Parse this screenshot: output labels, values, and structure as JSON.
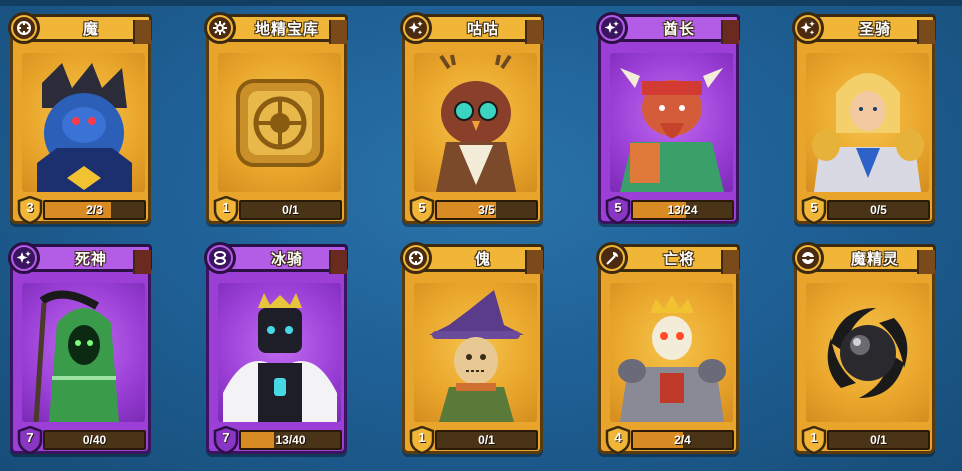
{
  "cards": [
    {
      "name": "魔",
      "level": "3",
      "progress": "2/3",
      "fill": 0.67,
      "rarity": "gold",
      "class_icon": "target-icon",
      "portrait": "demon-knight-portrait"
    },
    {
      "name": "地精宝库",
      "level": "1",
      "progress": "0/1",
      "fill": 0,
      "rarity": "gold",
      "class_icon": "gear-icon",
      "portrait": "goblin-vault-portrait"
    },
    {
      "name": "咕咕",
      "level": "5",
      "progress": "3/5",
      "fill": 0.6,
      "rarity": "gold",
      "class_icon": "sparkle-icon",
      "portrait": "owl-druid-portrait"
    },
    {
      "name": "酋长",
      "level": "5",
      "progress": "13/24",
      "fill": 0.54,
      "rarity": "purple",
      "class_icon": "sparkle-icon",
      "portrait": "minotaur-chief-portrait"
    },
    {
      "name": "圣骑",
      "level": "5",
      "progress": "0/5",
      "fill": 0,
      "rarity": "gold",
      "class_icon": "sparkle-icon",
      "portrait": "paladin-portrait"
    },
    {
      "name": "死神",
      "level": "7",
      "progress": "0/40",
      "fill": 0,
      "rarity": "purple",
      "class_icon": "sparkle-icon",
      "portrait": "reaper-portrait"
    },
    {
      "name": "冰骑",
      "level": "7",
      "progress": "13/40",
      "fill": 0.33,
      "rarity": "purple",
      "class_icon": "infinity-icon",
      "portrait": "ice-knight-portrait"
    },
    {
      "name": "傀",
      "level": "1",
      "progress": "0/1",
      "fill": 0,
      "rarity": "gold",
      "class_icon": "target-icon",
      "portrait": "scarecrow-portrait"
    },
    {
      "name": "亡将",
      "level": "4",
      "progress": "2/4",
      "fill": 0.5,
      "rarity": "gold",
      "class_icon": "axe-icon",
      "portrait": "undead-general-portrait"
    },
    {
      "name": "魔精灵",
      "level": "1",
      "progress": "0/1",
      "fill": 0,
      "rarity": "gold",
      "class_icon": "orb-icon",
      "portrait": "dark-orb-portrait"
    }
  ],
  "colors": {
    "background": "#1f6197",
    "gold_card": "#e9a52b",
    "purple_card": "#9b3fd6",
    "bar_fill": "#d98b23"
  }
}
